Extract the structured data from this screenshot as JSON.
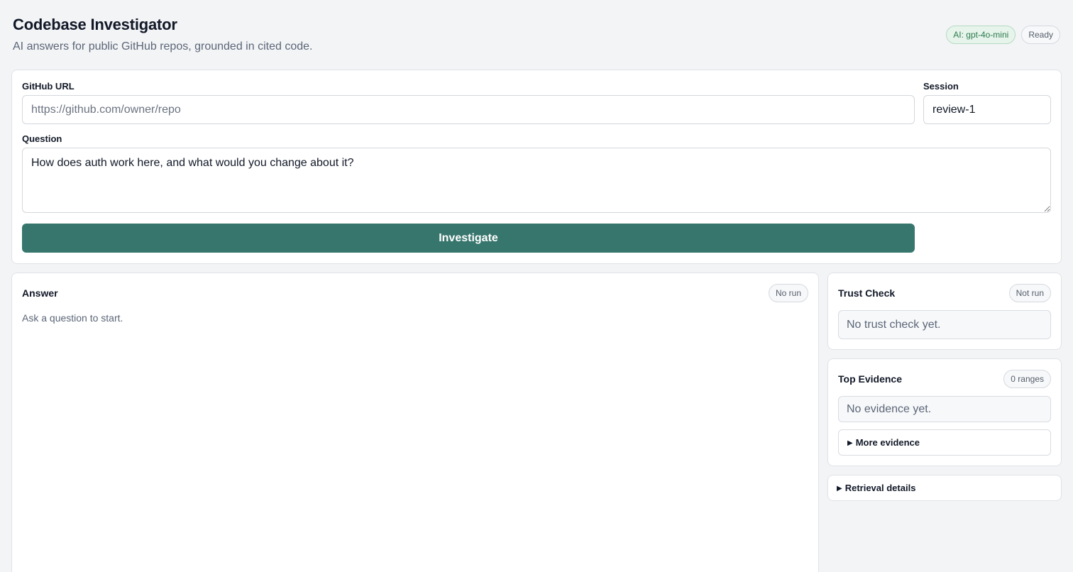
{
  "header": {
    "title": "Codebase Investigator",
    "subtitle": "AI answers for public GitHub repos, grounded in cited code.",
    "model_badge": "AI: gpt-4o-mini",
    "status_badge": "Ready"
  },
  "form": {
    "github_url_label": "GitHub URL",
    "github_url_placeholder": "https://github.com/owner/repo",
    "github_url_value": "",
    "session_label": "Session",
    "session_value": "review-1",
    "question_label": "Question",
    "question_value": "How does auth work here, and what would you change about it?",
    "submit_label": "Investigate"
  },
  "answer": {
    "title": "Answer",
    "badge": "No run",
    "empty_text": "Ask a question to start."
  },
  "trust_check": {
    "title": "Trust Check",
    "badge": "Not run",
    "empty_text": "No trust check yet."
  },
  "top_evidence": {
    "title": "Top Evidence",
    "badge": "0 ranges",
    "empty_text": "No evidence yet.",
    "more_label": "More evidence"
  },
  "retrieval": {
    "label": "Retrieval details"
  },
  "colors": {
    "accent": "#37766d",
    "background": "#f3f4f6",
    "model_badge": "#2c7a4b"
  }
}
